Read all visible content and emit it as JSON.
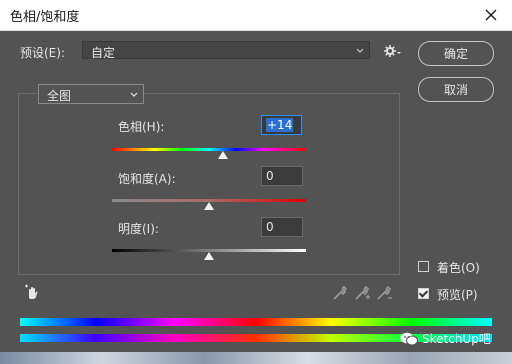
{
  "window": {
    "title": "色相/饱和度"
  },
  "preset": {
    "label": "预设(E):",
    "value": "自定"
  },
  "buttons": {
    "ok": "确定",
    "cancel": "取消"
  },
  "channel": {
    "value": "全图"
  },
  "hue": {
    "label": "色相(H):",
    "value": "+14",
    "position": 0.57
  },
  "saturation": {
    "label": "饱和度(A):",
    "value": "0",
    "position": 0.5
  },
  "lightness": {
    "label": "明度(I):",
    "value": "0",
    "position": 0.5
  },
  "colorize": {
    "label": "着色(O)",
    "checked": false
  },
  "preview": {
    "label": "预览(P)",
    "checked": true
  },
  "watermark": {
    "text": "SketchUp吧"
  },
  "colors": {
    "accent": "#2f8fff",
    "background": "#535353"
  }
}
